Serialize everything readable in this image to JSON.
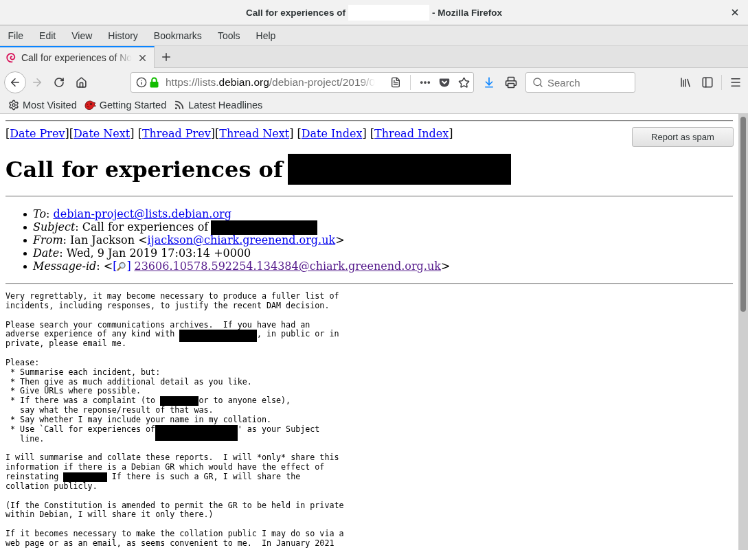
{
  "window": {
    "title": [
      {
        "kind": "text",
        "text": "Call for experiences of"
      },
      {
        "kind": "redaction"
      },
      {
        "kind": "text",
        "text": "- Mozilla Firefox"
      }
    ]
  },
  "menu_bar": [
    "File",
    "Edit",
    "View",
    "History",
    "Bookmarks",
    "Tools",
    "Help"
  ],
  "tabs": [
    {
      "title": "Call for experiences of No",
      "selected": true
    }
  ],
  "navigation": {
    "buttons": [
      {
        "kind": "back",
        "disabled": false
      },
      {
        "kind": "forward",
        "disabled": true
      },
      {
        "kind": "reload",
        "disabled": false
      },
      {
        "kind": "home",
        "disabled": false
      }
    ],
    "address": {
      "prefix": "https://lists.",
      "domain": "debian.org",
      "path": "/debian-project/2019/0"
    },
    "search": {
      "placeholder": "Search"
    }
  },
  "bookmarks": [
    {
      "kind": "folder",
      "label": "Most Visited"
    },
    {
      "kind": "page",
      "label": "Getting Started"
    },
    {
      "kind": "feed",
      "label": "Latest Headlines"
    }
  ],
  "page": {
    "nav_links": [
      {
        "kind": "text",
        "text": "["
      },
      {
        "kind": "link",
        "text": "Date Prev"
      },
      {
        "kind": "text",
        "text": "]["
      },
      {
        "kind": "link",
        "text": "Date Next"
      },
      {
        "kind": "text",
        "text": "] ["
      },
      {
        "kind": "link",
        "text": "Thread Prev"
      },
      {
        "kind": "text",
        "text": "]["
      },
      {
        "kind": "link",
        "text": "Thread Next"
      },
      {
        "kind": "text",
        "text": "] ["
      },
      {
        "kind": "link",
        "text": "Date Index"
      },
      {
        "kind": "text",
        "text": "] ["
      },
      {
        "kind": "link",
        "text": "Thread Index"
      },
      {
        "kind": "text",
        "text": "]"
      }
    ],
    "report_button": "Report as spam",
    "heading": [
      {
        "kind": "text",
        "text": "Call for experiences of"
      },
      {
        "kind": "redaction"
      }
    ],
    "headers": [
      {
        "parts": [
          {
            "kind": "text",
            "text": "*To*: "
          },
          {
            "kind": "link",
            "text": "debian-project@lists.debian.org",
            "visited": false
          }
        ]
      },
      {
        "parts": [
          {
            "kind": "text",
            "text": "*Subject*: Call for experiences of"
          },
          {
            "kind": "redaction"
          }
        ]
      },
      {
        "parts": [
          {
            "kind": "text",
            "text": "*From*: Ian Jackson <"
          },
          {
            "kind": "link",
            "text": "ijackson@chiark.greenend.org.uk",
            "visited": false
          },
          {
            "kind": "text",
            "text": ">"
          }
        ]
      },
      {
        "parts": [
          {
            "kind": "text",
            "text": "*Date*: Wed, 9 Jan 2019 17:03:14 +0000"
          }
        ]
      },
      {
        "parts": [
          {
            "kind": "text",
            "text": "*Message-id*: <"
          },
          {
            "kind": "icon-link",
            "open": "[",
            "close": "]",
            "visited": false
          },
          {
            "kind": "link",
            "text": "23606.10578.592254.134384@chiark.greenend.org.uk",
            "visited": true
          },
          {
            "kind": "text",
            "text": ">"
          }
        ]
      }
    ],
    "body": [
      {
        "lines": [
          {
            "kind": "plain",
            "text": "Very regrettably, it may become necessary to produce a fuller list of"
          },
          {
            "kind": "plain",
            "text": "incidents, including responses, to justify the recent DAM decision."
          }
        ]
      },
      {
        "lines": [
          {
            "kind": "plain",
            "text": "Please search your communications archives.  If you have had an"
          },
          {
            "kind": "redacted",
            "parts": [
              {
                "kind": "text",
                "text": "adverse experience of any kind with "
              },
              {
                "kind": "redaction"
              },
              {
                "kind": "text",
                "text": ", in public or in"
              }
            ]
          },
          {
            "kind": "plain",
            "text": "private, please email me."
          }
        ]
      },
      {
        "lines": [
          {
            "kind": "plain",
            "text": "Please:"
          },
          {
            "kind": "plain",
            "text": " * Summarise each incident, but:"
          },
          {
            "kind": "plain",
            "text": " * Then give as much additional detail as you like."
          },
          {
            "kind": "plain",
            "text": " * Give URLs where possible."
          },
          {
            "kind": "redacted",
            "parts": [
              {
                "kind": "text",
                "text": " * If there was a complaint (to "
              },
              {
                "kind": "redaction"
              },
              {
                "kind": "text",
                "text": "or to anyone else),"
              }
            ]
          },
          {
            "kind": "plain",
            "text": "   say what the reponse/result of that was."
          },
          {
            "kind": "plain",
            "text": " * Say whether I may include your name in my collation."
          },
          {
            "kind": "redacted",
            "parts": [
              {
                "kind": "text",
                "text": " * Use `Call for experiences of"
              },
              {
                "kind": "redaction"
              },
              {
                "kind": "text",
                "text": "' as your Subject"
              }
            ]
          },
          {
            "kind": "plain",
            "text": "   line."
          }
        ]
      },
      {
        "lines": [
          {
            "kind": "plain",
            "text": "I will summarise and collate these reports.  I will *only* share this"
          },
          {
            "kind": "plain",
            "text": "information if there is a Debian GR which would have the effect of"
          },
          {
            "kind": "redacted",
            "parts": [
              {
                "kind": "text",
                "text": "reinstating "
              },
              {
                "kind": "redaction"
              },
              {
                "kind": "text",
                "text": " If there is such a GR, I will share the"
              }
            ]
          },
          {
            "kind": "plain",
            "text": "collation publicly."
          }
        ]
      },
      {
        "lines": [
          {
            "kind": "plain",
            "text": "(If the Constitution is amended to permit the GR to be held in private"
          },
          {
            "kind": "plain",
            "text": "within Debian, I will share it only there.)"
          }
        ]
      },
      {
        "lines": [
          {
            "kind": "plain",
            "text": "If it becomes necessary to make the collation public I may do so via a"
          },
          {
            "kind": "plain",
            "text": "web page or as an email, as seems convenient to me.  In January 2021"
          }
        ]
      }
    ]
  }
}
